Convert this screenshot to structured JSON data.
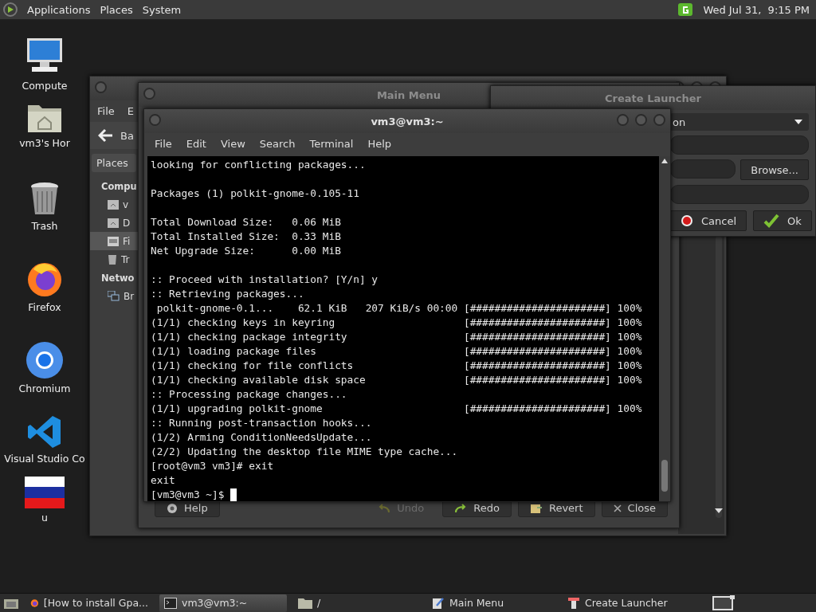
{
  "top_panel": {
    "menus": [
      "Applications",
      "Places",
      "System"
    ],
    "clock": "Wed Jul 31,  9:15 PM"
  },
  "desktop_icons": [
    {
      "label": "Compute",
      "kind": "computer"
    },
    {
      "label": "vm3's Hor",
      "kind": "home"
    },
    {
      "label": "Trash",
      "kind": "trash"
    },
    {
      "label": "Firefox",
      "kind": "firefox"
    },
    {
      "label": "Chromium",
      "kind": "chromium"
    },
    {
      "label": "Visual Studio Co",
      "kind": "vscode"
    },
    {
      "label": "u",
      "kind": "flag"
    }
  ],
  "file_manager": {
    "menus": [
      "File",
      "E"
    ],
    "back_button": "Ba",
    "sidebar_header": "Places",
    "sidebar": [
      {
        "label": "Compu",
        "kind": "heading",
        "selected": false
      },
      {
        "label": "v",
        "kind": "home",
        "selected": false
      },
      {
        "label": "D",
        "kind": "home",
        "selected": false
      },
      {
        "label": "Fi",
        "kind": "drive",
        "selected": true
      },
      {
        "label": "Tr",
        "kind": "trash",
        "selected": false
      },
      {
        "label": "Netwo",
        "kind": "heading",
        "selected": false
      },
      {
        "label": "Br",
        "kind": "network",
        "selected": false
      }
    ]
  },
  "main_menu": {
    "title": "Main Menu",
    "buttons": [
      {
        "label": "Help",
        "kind": "help",
        "disabled": false
      },
      {
        "label": "Undo",
        "kind": "undo",
        "disabled": true
      },
      {
        "label": "Redo",
        "kind": "redo",
        "disabled": false
      },
      {
        "label": "Revert",
        "kind": "revert",
        "disabled": false
      },
      {
        "label": "Close",
        "kind": "close",
        "disabled": false
      }
    ]
  },
  "create_launcher": {
    "title": "Create Launcher",
    "type_value": "on",
    "browse_button": "Browse...",
    "cancel_button": "Cancel",
    "ok_button": "Ok"
  },
  "terminal": {
    "title": "vm3@vm3:~",
    "menus": [
      "File",
      "Edit",
      "View",
      "Search",
      "Terminal",
      "Help"
    ],
    "blocks": [
      [
        {
          "text": "looking for conflicting packages..."
        }
      ],
      [
        {
          "text": "Packages (1) polkit-gnome-0.105-11"
        }
      ],
      [
        {
          "text": "Total Download Size:   0.06 MiB"
        },
        {
          "text": "Total Installed Size:  0.33 MiB"
        },
        {
          "text": "Net Upgrade Size:      0.00 MiB"
        }
      ],
      [
        {
          "text": ":: Proceed with installation? [Y/n] y"
        },
        {
          "text": ":: Retrieving packages..."
        },
        {
          "text": " polkit-gnome-0.1...    62.1 KiB   207 KiB/s 00:00",
          "bar": "[######################] 100%"
        },
        {
          "text": "(1/1) checking keys in keyring",
          "bar": "[######################] 100%"
        },
        {
          "text": "(1/1) checking package integrity",
          "bar": "[######################] 100%"
        },
        {
          "text": "(1/1) loading package files",
          "bar": "[######################] 100%"
        },
        {
          "text": "(1/1) checking for file conflicts",
          "bar": "[######################] 100%"
        },
        {
          "text": "(1/1) checking available disk space",
          "bar": "[######################] 100%"
        },
        {
          "text": ":: Processing package changes..."
        },
        {
          "text": "(1/1) upgrading polkit-gnome",
          "bar": "[######################] 100%"
        },
        {
          "text": ":: Running post-transaction hooks..."
        },
        {
          "text": "(1/2) Arming ConditionNeedsUpdate..."
        },
        {
          "text": "(2/2) Updating the desktop file MIME type cache..."
        },
        {
          "text": "[root@vm3 vm3]# exit"
        },
        {
          "text": "exit"
        },
        {
          "text": "[vm3@vm3 ~]$ ",
          "cursor": true
        }
      ]
    ]
  },
  "taskbar": {
    "items": [
      {
        "label": "[How to install Gpa...",
        "kind": "browser",
        "selected": false
      },
      {
        "label": "vm3@vm3:~",
        "kind": "terminal",
        "selected": true
      },
      {
        "label": "/",
        "kind": "folder",
        "selected": false
      },
      {
        "label": "Main Menu",
        "kind": "editor",
        "selected": false
      },
      {
        "label": "Create Launcher",
        "kind": "launcher",
        "selected": false
      }
    ]
  }
}
